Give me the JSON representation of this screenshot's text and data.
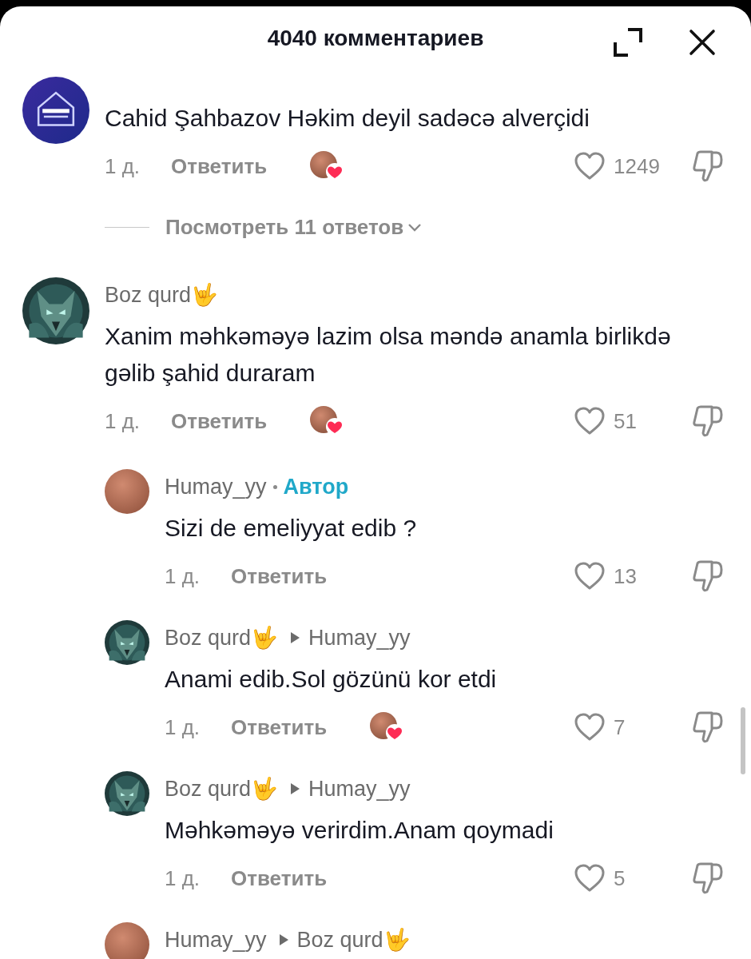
{
  "header": {
    "title": "4040 комментариев"
  },
  "comments": [
    {
      "text": "Cahid Şahbazov Həkim deyil sadəcə alverçidi",
      "time": "1 д.",
      "reply_label": "Ответить",
      "creator_liked": true,
      "likes": "1249",
      "view_replies": "Посмотреть 11 ответов"
    },
    {
      "author": "Boz qurd🤟",
      "text": "Xanim məhkəməyə lazim olsa məndə anamla birlikdə gəlib şahid duraram",
      "time": "1 д.",
      "reply_label": "Ответить",
      "creator_liked": true,
      "likes": "51",
      "replies": [
        {
          "author": "Humay_yy",
          "author_badge": "Автор",
          "text": "Sizi de emeliyyat edib ?",
          "time": "1 д.",
          "reply_label": "Ответить",
          "creator_liked": false,
          "likes": "13"
        },
        {
          "author": "Boz qurd🤟",
          "reply_to": "Humay_yy",
          "text": "Anami edib.Sol gözünü kor etdi",
          "time": "1 д.",
          "reply_label": "Ответить",
          "creator_liked": true,
          "likes": "7"
        },
        {
          "author": "Boz qurd🤟",
          "reply_to": "Humay_yy",
          "text": "Məhkəməyə verirdim.Anam qoymadi",
          "time": "1 д.",
          "reply_label": "Ответить",
          "creator_liked": false,
          "likes": "5"
        },
        {
          "author": "Humay_yy",
          "reply_to": "Boz qurd🤟"
        }
      ]
    }
  ]
}
